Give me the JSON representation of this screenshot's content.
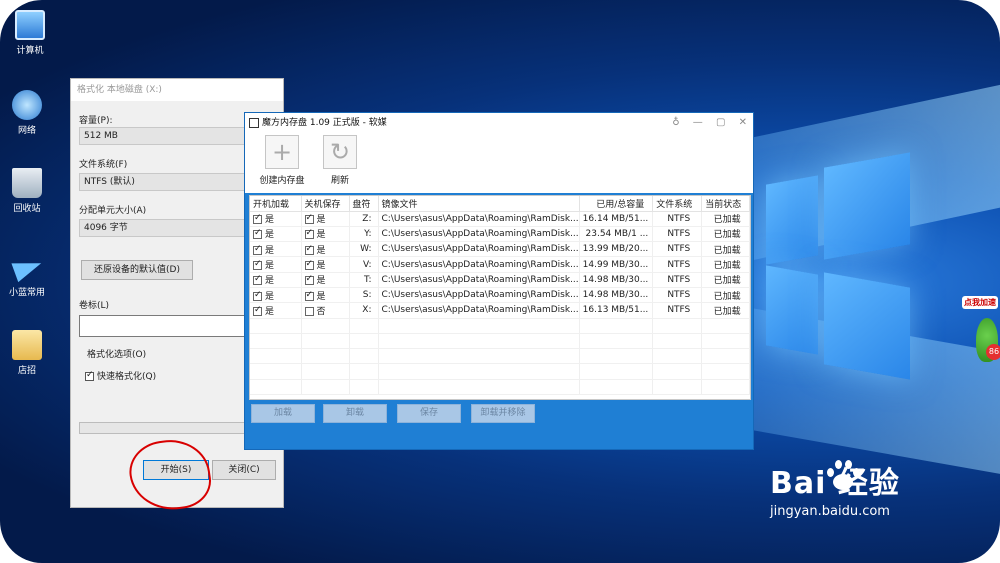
{
  "desktop": {
    "icons": [
      {
        "label": "计算机",
        "icon": "computer-icon"
      },
      {
        "label": "网络",
        "icon": "network-icon"
      },
      {
        "label": "回收站",
        "icon": "recycle-bin-icon"
      },
      {
        "label": "小蓝常用",
        "icon": "paper-plane-icon"
      },
      {
        "label": "店招",
        "icon": "folder-file-icon"
      }
    ],
    "side_badge": "点我加速",
    "side_badge_number": "86"
  },
  "format_dialog": {
    "title": "格式化 本地磁盘 (X:)",
    "capacity_label": "容量(P):",
    "capacity_value": "512 MB",
    "filesystem_label": "文件系统(F)",
    "filesystem_value": "NTFS (默认)",
    "alloc_label": "分配单元大小(A)",
    "alloc_value": "4096 字节",
    "restore_button": "还原设备的默认值(D)",
    "volume_label": "卷标(L)",
    "volume_value": "",
    "options_label": "格式化选项(O)",
    "quick_format": "快速格式化(Q)",
    "start_button": "开始(S)",
    "close_button": "关闭(C)"
  },
  "ramdisk": {
    "title": "魔方内存盘 1.09 正式版 - 软媒",
    "toolbar": {
      "create_label": "创建内存盘",
      "refresh_label": "刷新"
    },
    "columns": [
      "开机加载",
      "关机保存",
      "盘符",
      "镜像文件",
      "已用/总容量",
      "文件系统",
      "当前状态"
    ],
    "rows": [
      {
        "boot": "是",
        "boot_checked": true,
        "save": "是",
        "save_checked": true,
        "drive": "Z:",
        "image": "C:\\Users\\asus\\AppData\\Roaming\\RamDisk...",
        "usage": "16.14 MB/51...",
        "fs": "NTFS",
        "status": "已加载"
      },
      {
        "boot": "是",
        "boot_checked": true,
        "save": "是",
        "save_checked": true,
        "drive": "Y:",
        "image": "C:\\Users\\asus\\AppData\\Roaming\\RamDisk...",
        "usage": "23.54 MB/1 ...",
        "fs": "NTFS",
        "status": "已加载"
      },
      {
        "boot": "是",
        "boot_checked": true,
        "save": "是",
        "save_checked": true,
        "drive": "W:",
        "image": "C:\\Users\\asus\\AppData\\Roaming\\RamDisk...",
        "usage": "13.99 MB/20...",
        "fs": "NTFS",
        "status": "已加载"
      },
      {
        "boot": "是",
        "boot_checked": true,
        "save": "是",
        "save_checked": true,
        "drive": "V:",
        "image": "C:\\Users\\asus\\AppData\\Roaming\\RamDisk...",
        "usage": "14.99 MB/30...",
        "fs": "NTFS",
        "status": "已加载"
      },
      {
        "boot": "是",
        "boot_checked": true,
        "save": "是",
        "save_checked": true,
        "drive": "T:",
        "image": "C:\\Users\\asus\\AppData\\Roaming\\RamDisk...",
        "usage": "14.98 MB/30...",
        "fs": "NTFS",
        "status": "已加载"
      },
      {
        "boot": "是",
        "boot_checked": true,
        "save": "是",
        "save_checked": true,
        "drive": "S:",
        "image": "C:\\Users\\asus\\AppData\\Roaming\\RamDisk...",
        "usage": "14.98 MB/30...",
        "fs": "NTFS",
        "status": "已加载"
      },
      {
        "boot": "是",
        "boot_checked": true,
        "save": "否",
        "save_checked": false,
        "drive": "X:",
        "image": "C:\\Users\\asus\\AppData\\Roaming\\RamDisk...",
        "usage": "16.13 MB/51...",
        "fs": "NTFS",
        "status": "已加载"
      }
    ],
    "actions": {
      "load": "加载",
      "unload": "卸载",
      "save": "保存",
      "unload_remove": "卸载并移除"
    }
  },
  "watermark": {
    "brand": "Bai  经验",
    "url": "jingyan.baidu.com"
  }
}
